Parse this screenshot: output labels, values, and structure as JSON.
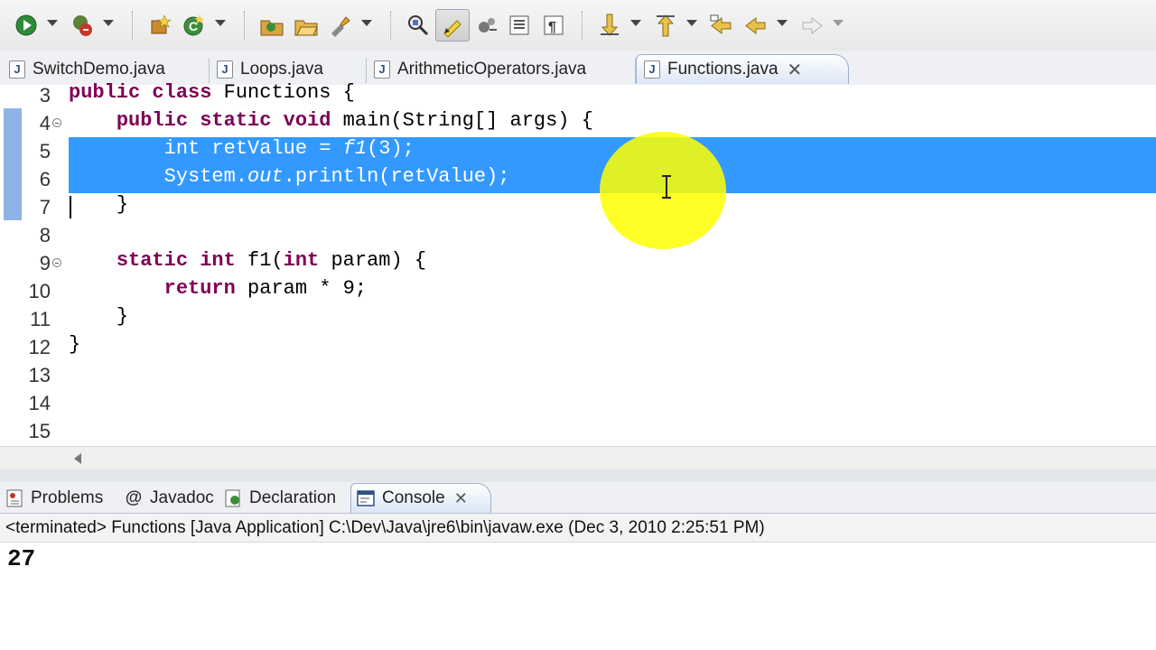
{
  "toolbar": {
    "buttons": [
      "run-icon",
      "debug-icon",
      "new-java-package-icon",
      "new-java-class-icon",
      "open-type-icon",
      "open-folder-icon",
      "search-icon",
      "toggle-breakpoint-icon",
      "toggle-mark-occurrences-icon",
      "word-wrap-icon",
      "block-selection-icon",
      "show-whitespace-icon",
      "next-annotation-icon",
      "previous-annotation-icon",
      "last-edit-location-icon",
      "back-icon",
      "forward-icon"
    ]
  },
  "editor_tabs": [
    {
      "label": "SwitchDemo.java",
      "active": false
    },
    {
      "label": "Loops.java",
      "active": false
    },
    {
      "label": "ArithmeticOperators.java",
      "active": false
    },
    {
      "label": "Functions.java",
      "active": true
    }
  ],
  "editor": {
    "line_numbers": [
      "3",
      "4",
      "5",
      "6",
      "7",
      "8",
      "9",
      "10",
      "11",
      "12",
      "13",
      "14",
      "15"
    ],
    "lines": {
      "l3": {
        "kw1": "public",
        "kw2": "class",
        "rest": " Functions {"
      },
      "l4": {
        "kw1": "public",
        "kw2": "static",
        "kw3": "void",
        "rest": " main(String[] args) {"
      },
      "l5": {
        "kw": "int",
        "mid": " retValue = ",
        "call": "f1",
        "rest": "(3);"
      },
      "l6": {
        "pre": "System.",
        "field": "out",
        "rest": ".println(retValue);"
      },
      "l7": {
        "text": "}"
      },
      "l9": {
        "kw1": "static",
        "kw2": "int",
        "mid": " f1(",
        "kw3": "int",
        "rest": " param) {"
      },
      "l10": {
        "kw": "return",
        "rest": " param * 9;"
      },
      "l11": {
        "text": "}"
      },
      "l12": {
        "text": "}"
      }
    }
  },
  "panel_tabs": [
    {
      "label": "Problems",
      "icon": "problems-icon"
    },
    {
      "label": "Javadoc",
      "icon": "javadoc-icon"
    },
    {
      "label": "Declaration",
      "icon": "declaration-icon"
    },
    {
      "label": "Console",
      "icon": "console-icon",
      "active": true
    }
  ],
  "console": {
    "status": "<terminated> Functions [Java Application] C:\\Dev\\Java\\jre6\\bin\\javaw.exe (Dec 3, 2010 2:25:51 PM)",
    "output": "27"
  },
  "colors": {
    "keyword": "#7f0055",
    "selection": "#3399ff",
    "cursor_highlight": "#ffff00"
  }
}
